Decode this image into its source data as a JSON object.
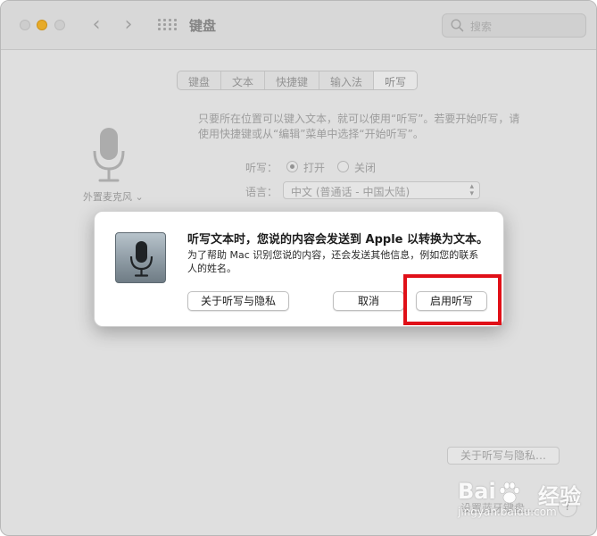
{
  "window": {
    "title": "键盘",
    "search_placeholder": "搜索"
  },
  "tabs": [
    {
      "label": "键盘"
    },
    {
      "label": "文本"
    },
    {
      "label": "快捷键"
    },
    {
      "label": "输入法"
    },
    {
      "label": "听写"
    }
  ],
  "dictation": {
    "mic_source": "外置麦克风",
    "description": "只要所在位置可以键入文本，就可以使用“听写”。若要开始听写，请使用快捷键或从“编辑”菜单中选择“开始听写”。",
    "toggle_label": "听写：",
    "on_label": "打开",
    "off_label": "关闭",
    "language_label": "语言：",
    "language_value": "中文 (普通话 - 中国大陆)",
    "about_button": "关于听写与隐私…",
    "bottom_button": "设置蓝牙键盘…"
  },
  "dialog": {
    "title": "听写文本时，您说的内容会发送到 Apple 以转换为文本。",
    "body": "为了帮助 Mac 识别您说的内容，还会发送其他信息，例如您的联系人的姓名。",
    "privacy_button": "关于听写与隐私",
    "cancel_button": "取消",
    "enable_button": "启用听写"
  },
  "watermark": {
    "text": "Bai",
    "text2": "经验",
    "url": "jingyan.baidu.com"
  },
  "colors": {
    "highlight": "#e01018",
    "minimize": "#f5b327"
  }
}
